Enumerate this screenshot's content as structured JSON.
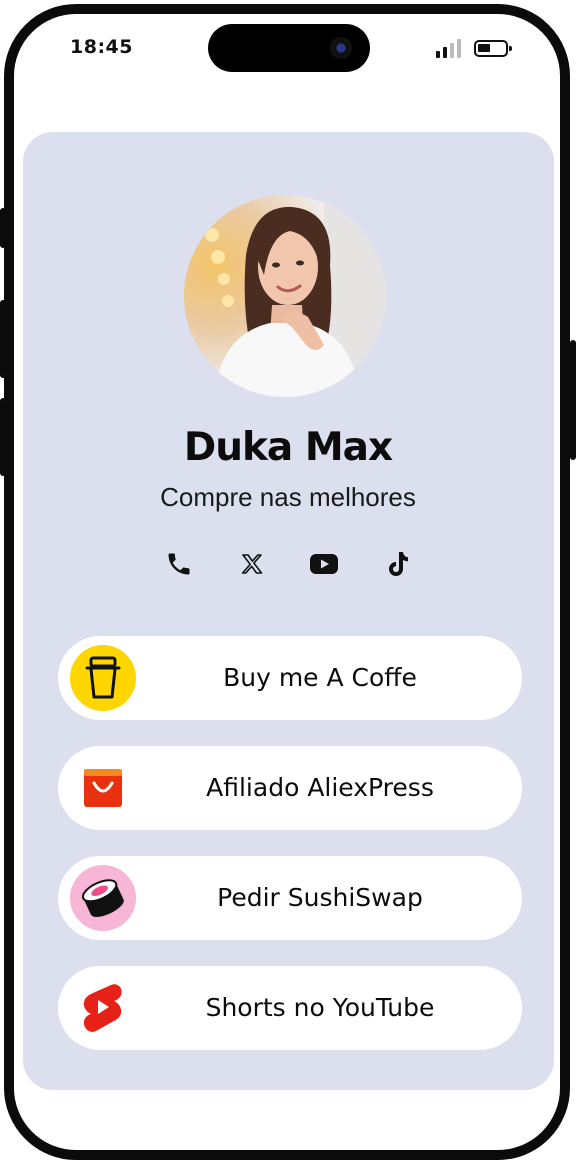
{
  "status_bar": {
    "time": "18:45"
  },
  "profile": {
    "name": "Duka Max",
    "subtitle": "Compre nas melhores"
  },
  "social_icons": [
    "phone-icon",
    "x-twitter-icon",
    "youtube-icon",
    "tiktok-icon"
  ],
  "links": [
    {
      "label": "Buy me A Coffe",
      "icon": "coffee-cup-icon",
      "icon_bg": "#ffd600"
    },
    {
      "label": "Afiliado AliexPress",
      "icon": "aliexpress-bag-icon",
      "icon_bg": "#ffffff"
    },
    {
      "label": "Pedir SushiSwap",
      "icon": "sushiswap-icon",
      "icon_bg": "#f7b6d6"
    },
    {
      "label": "Shorts no YouTube",
      "icon": "youtube-shorts-icon",
      "icon_bg": "#ffffff"
    }
  ],
  "colors": {
    "card_bg": "#dce0ee",
    "button_bg": "#ffffff",
    "frame": "#0b0b0b",
    "coffee_yellow": "#ffd600",
    "aliexpress_red": "#e8320f",
    "shorts_red": "#e62117"
  }
}
